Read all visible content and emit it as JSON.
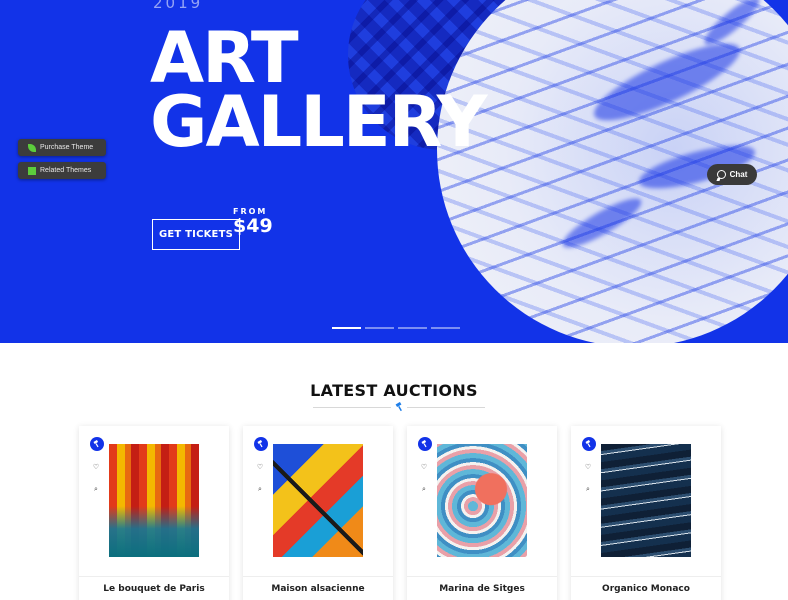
{
  "hero": {
    "year": "2019",
    "title_line1": "ART",
    "title_line2": "GALLERY",
    "cta_label": "GET TICKETS",
    "price_prefix": "FROM",
    "price": "$49",
    "background_color": "#1233e8",
    "slides": 4,
    "active_slide": 1
  },
  "side_buttons": [
    {
      "label": "Purchase Theme",
      "icon": "leaf-icon"
    },
    {
      "label": "Related Themes",
      "icon": "grid-icon"
    }
  ],
  "chat": {
    "label": "Chat",
    "icon": "chat-bubble-icon"
  },
  "auctions": {
    "title": "LATEST AUCTIONS",
    "divider_icon": "gavel-icon",
    "items": [
      {
        "name": "Le bouquet de Paris",
        "badge_icon": "gavel-icon",
        "actions": [
          "heart-icon",
          "zoom-icon"
        ]
      },
      {
        "name": "Maison alsacienne",
        "badge_icon": "gavel-icon",
        "actions": [
          "heart-icon",
          "zoom-icon"
        ]
      },
      {
        "name": "Marina de Sitges",
        "badge_icon": "gavel-icon",
        "actions": [
          "heart-icon",
          "zoom-icon"
        ]
      },
      {
        "name": "Organico Monaco",
        "badge_icon": "gavel-icon",
        "actions": [
          "heart-icon",
          "zoom-icon"
        ]
      }
    ]
  }
}
